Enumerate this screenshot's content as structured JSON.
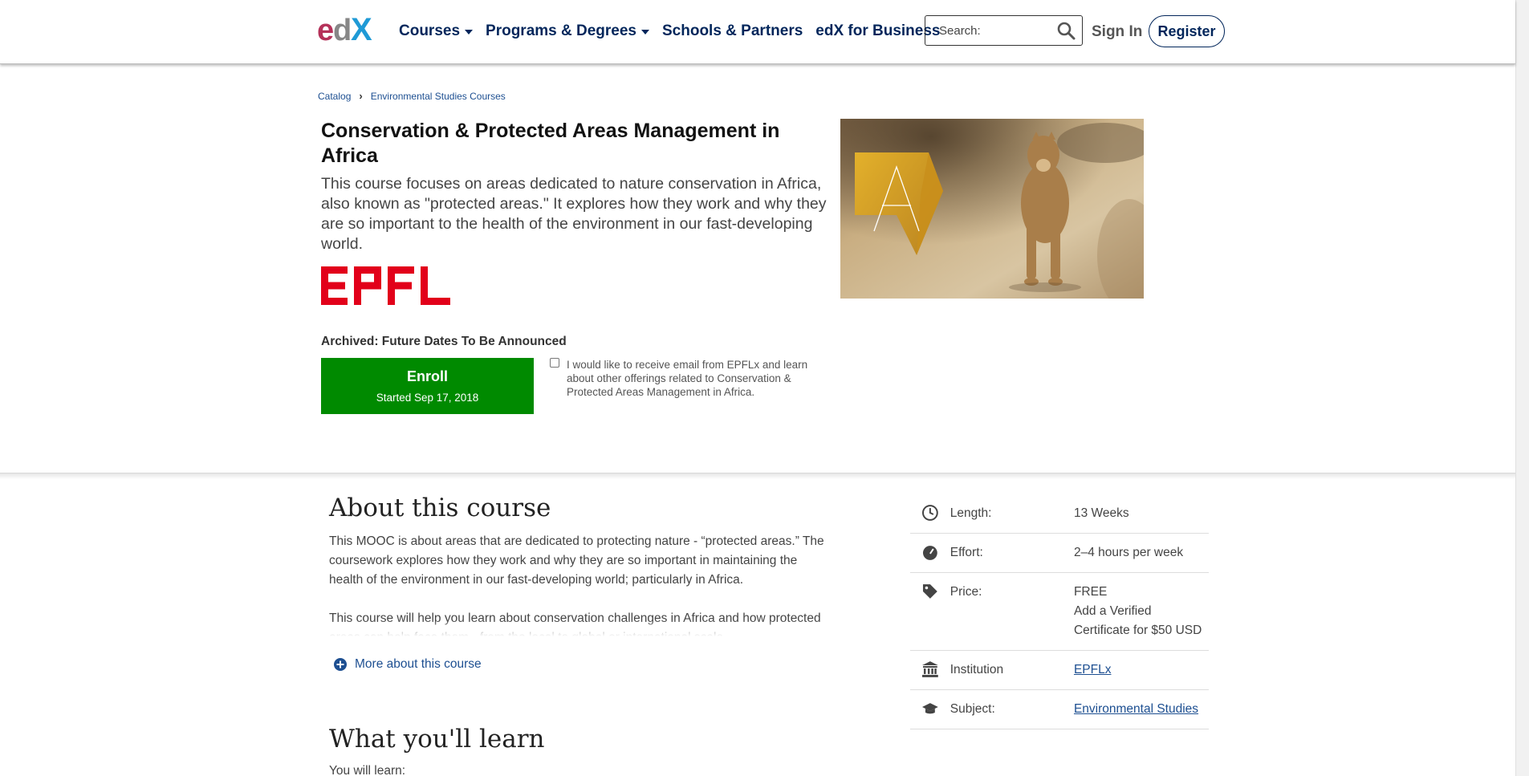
{
  "header": {
    "logo_alt": "edX",
    "nav": [
      {
        "label": "Courses",
        "dropdown": true
      },
      {
        "label": "Programs & Degrees",
        "dropdown": true
      },
      {
        "label": "Schools & Partners",
        "dropdown": false
      },
      {
        "label": "edX for Business",
        "dropdown": false
      }
    ],
    "search_placeholder": "Search:",
    "sign_in": "Sign In",
    "register": "Register"
  },
  "breadcrumb": [
    "Catalog",
    "Environmental Studies Courses"
  ],
  "course": {
    "title": "Conservation & Protected Areas Management in Africa",
    "description": "This course focuses on areas dedicated to nature conservation in Africa, also known as \"protected areas.\" It explores how they work and why they are so important to the health of the environment in our fast-developing world.",
    "institution_logo": "EPFL",
    "status": "Archived: Future Dates To Be Announced",
    "enroll_label": "Enroll",
    "enroll_sub": "Started Sep 17, 2018",
    "optin_text": "I would like to receive email from EPFLx and learn about other offerings related to Conservation & Protected Areas Management in Africa."
  },
  "about": {
    "heading": "About this course",
    "p1": "This MOOC is about areas that are dedicated to protecting nature - “protected areas.” The coursework explores how they work and why they are so important in maintaining the health of the environment in our fast-developing world; particularly in Africa.",
    "p2": "This course will help you learn about conservation challenges in Africa and how protected areas can help face them - from the local to global or international scale.",
    "more_link": "More about this course"
  },
  "learn": {
    "heading": "What you'll learn",
    "intro": "You will learn:"
  },
  "facts": [
    {
      "icon": "clock-icon",
      "label": "Length:",
      "value": "13 Weeks",
      "link": false
    },
    {
      "icon": "gauge-icon",
      "label": "Effort:",
      "value": "2–4 hours per week",
      "link": false
    },
    {
      "icon": "tag-icon",
      "label": "Price:",
      "value": "FREE",
      "value2": "Add a Verified Certificate for $50 USD",
      "link": false
    },
    {
      "icon": "institution-icon",
      "label": "Institution",
      "value": "EPFLx",
      "link": true
    },
    {
      "icon": "graduation-cap-icon",
      "label": "Subject:",
      "value": "Environmental Studies",
      "link": true
    }
  ],
  "colors": {
    "brand_navy": "#02265b",
    "link_blue": "#1d4f91",
    "enroll_green": "#008a00",
    "epfl_red": "#e2001a"
  }
}
